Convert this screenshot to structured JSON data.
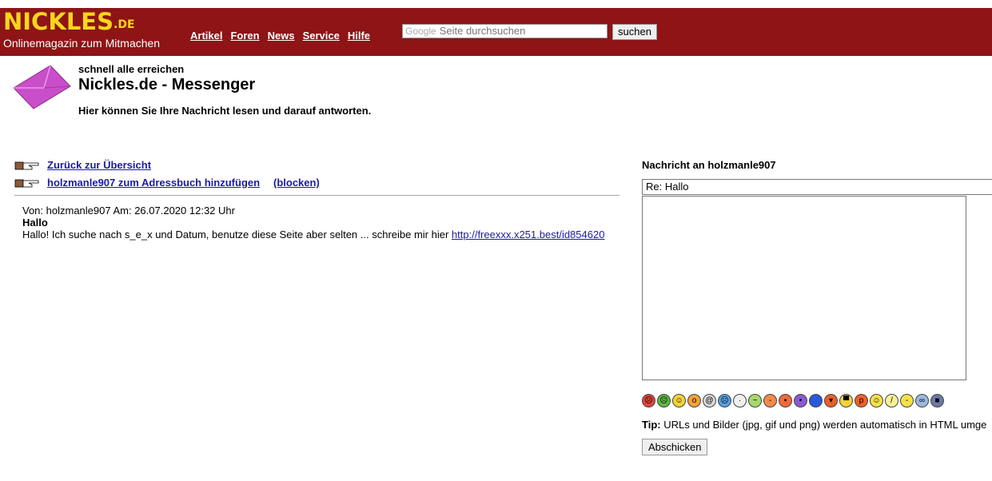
{
  "header": {
    "logo_main": "NICKLES",
    "logo_suffix": ".DE",
    "logo_sub": "Onlinemagazin zum Mitmachen",
    "nav": [
      "Artikel",
      "Foren",
      "News",
      "Service",
      "Hilfe"
    ],
    "search_brand": "Google",
    "search_placeholder": "Seite durchsuchen",
    "search_button": "suchen"
  },
  "intro": {
    "tagline": "schnell alle erreichen",
    "title": "Nickles.de - Messenger",
    "text": "Hier können Sie Ihre Nachricht lesen und darauf antworten."
  },
  "actions": {
    "back": "Zurück zur Übersicht",
    "add_contact": "holzmanle907 zum Adressbuch hinzufügen",
    "block": "(blocken)"
  },
  "message": {
    "meta": "Von: holzmanle907 Am: 26.07.2020 12:32 Uhr",
    "subject": "Hallo",
    "body": "Hallo! Ich suche nach s_e_x und Datum, benutze diese Seite aber selten ... schreibe mir hier",
    "link": "http://freexxx.x251.best/id854620"
  },
  "reply": {
    "label": "Nachricht an holzmanle907",
    "subject_value": "Re: Hallo",
    "message_value": "",
    "tip_label": "Tip:",
    "tip_text": "URLs und Bilder (jpg, gif und png) werden automatisch in HTML umge",
    "submit": "Abschicken"
  },
  "smileys": [
    {
      "name": "angry-smiley",
      "color": "#e0443a",
      "glyph": "☹"
    },
    {
      "name": "sad-smiley",
      "color": "#5fb845",
      "glyph": "☹"
    },
    {
      "name": "smile-smiley",
      "color": "#f4d23a",
      "glyph": "☺"
    },
    {
      "name": "surprised-smiley",
      "color": "#f4a13a",
      "glyph": "o"
    },
    {
      "name": "dizzy-smiley",
      "color": "#d8d8d8",
      "glyph": "@"
    },
    {
      "name": "crying-smiley",
      "color": "#5aa0e0",
      "glyph": "☹"
    },
    {
      "name": "neutral-smiley",
      "color": "#efefef",
      "glyph": "·"
    },
    {
      "name": "sick-smiley",
      "color": "#a6d86a",
      "glyph": "~"
    },
    {
      "name": "embarrassed-smiley",
      "color": "#f28a4a",
      "glyph": "-"
    },
    {
      "name": "grin-smiley",
      "color": "#f06a3a",
      "glyph": "▪"
    },
    {
      "name": "alien-smiley",
      "color": "#8a5ad0",
      "glyph": "•"
    },
    {
      "name": "blue-smiley",
      "color": "#2a5ad8",
      "glyph": ""
    },
    {
      "name": "devil-smiley",
      "color": "#e8602a",
      "glyph": "▾"
    },
    {
      "name": "laugh-smiley",
      "color": "#f4d23a",
      "glyph": "▀"
    },
    {
      "name": "tongue-smiley",
      "color": "#f0602a",
      "glyph": "p"
    },
    {
      "name": "happy-smiley",
      "color": "#f4e04a",
      "glyph": "☺"
    },
    {
      "name": "confused-smiley",
      "color": "#f8f09a",
      "glyph": "/"
    },
    {
      "name": "meh-smiley",
      "color": "#f4e04a",
      "glyph": "-"
    },
    {
      "name": "group-smiley",
      "color": "#9ab8e0",
      "glyph": "∞"
    },
    {
      "name": "cool-smiley",
      "color": "#6a7aa8",
      "glyph": "■"
    }
  ]
}
